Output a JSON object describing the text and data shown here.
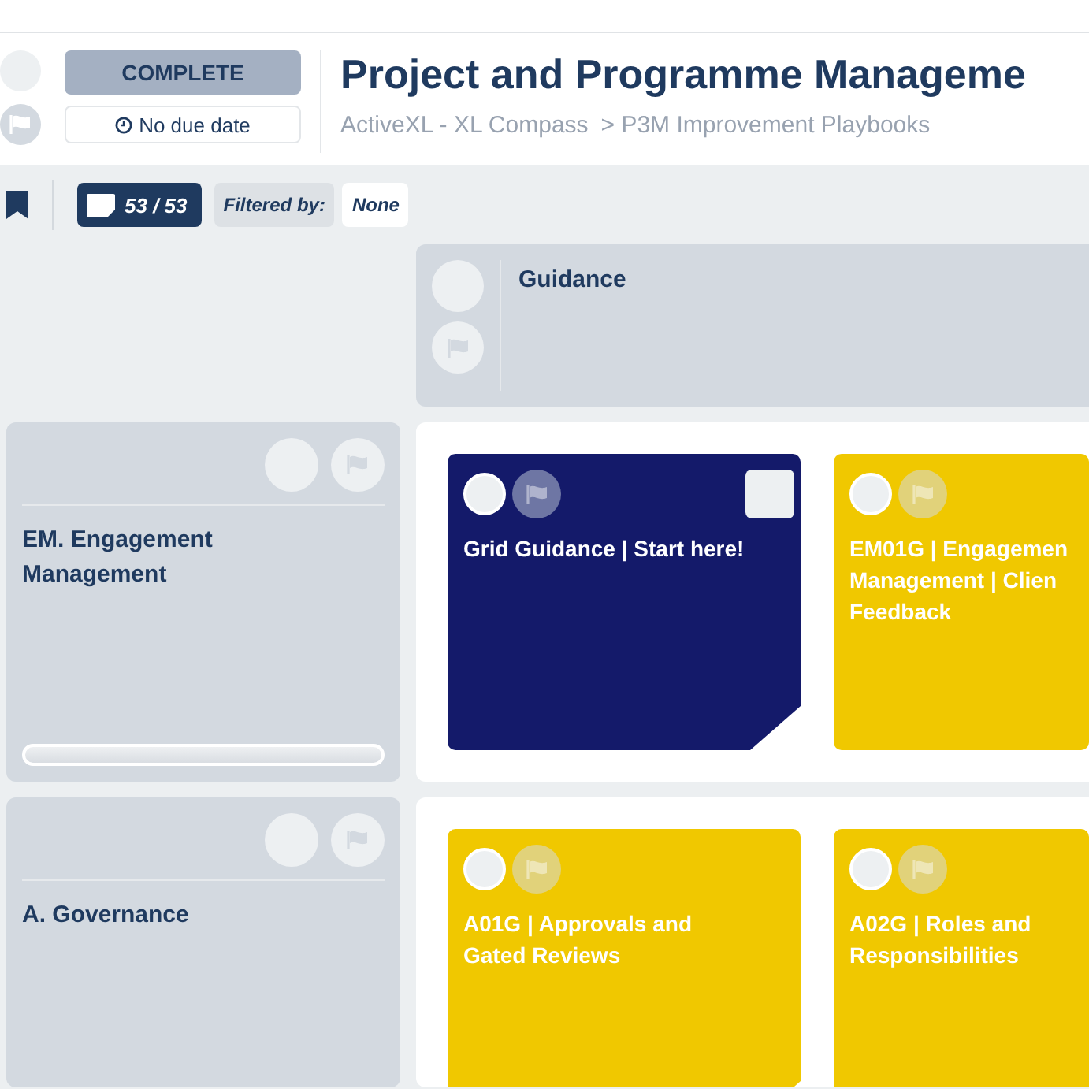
{
  "header": {
    "status": "COMPLETE",
    "due": "No due date",
    "title": "Project and Programme Manageme",
    "breadcrumb": [
      "ActiveXL - XL Compass",
      "> P3M Improvement Playbooks"
    ]
  },
  "toolbar": {
    "count": "53 / 53",
    "filter_label": "Filtered by:",
    "filter_value": "None"
  },
  "column_header": {
    "title": "Guidance"
  },
  "rows": [
    {
      "title": "EM. Engagement Management",
      "level": 0,
      "cards": [
        {
          "kind": "guidance",
          "lines": [
            "Grid Guidance | Start here!"
          ],
          "checked": false
        },
        {
          "kind": "task",
          "lines": [
            "EM01G | Engagemen",
            "Management | Clien",
            "Feedback"
          ]
        }
      ]
    },
    {
      "title": "A. Governance",
      "cards": [
        {
          "kind": "task",
          "lines": [
            "A01G | Approvals and",
            "Gated Reviews"
          ]
        },
        {
          "kind": "task",
          "lines": [
            "A02G | Roles and",
            "Responsibilities"
          ]
        }
      ]
    }
  ]
}
